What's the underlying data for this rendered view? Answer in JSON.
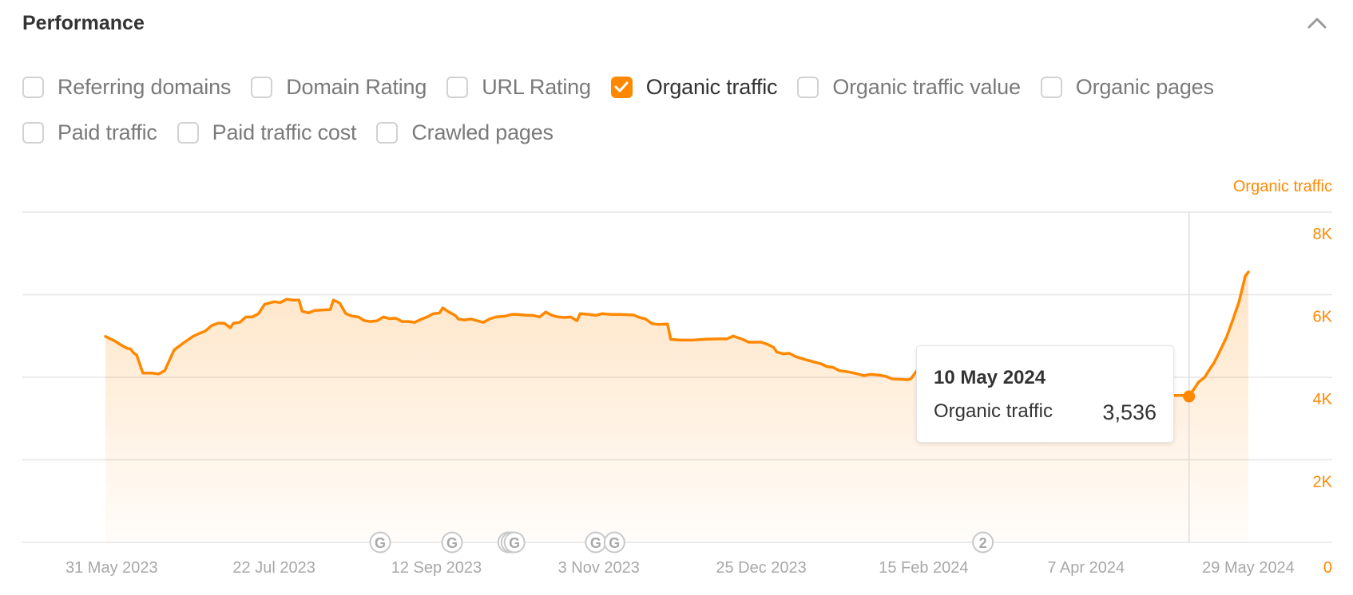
{
  "header": {
    "title": "Performance",
    "collapse_icon": "chevron-up-icon"
  },
  "metrics": [
    {
      "label": "Referring domains",
      "checked": false
    },
    {
      "label": "Domain Rating",
      "checked": false
    },
    {
      "label": "URL Rating",
      "checked": false
    },
    {
      "label": "Organic traffic",
      "checked": true
    },
    {
      "label": "Organic traffic value",
      "checked": false
    },
    {
      "label": "Organic pages",
      "checked": false
    },
    {
      "label": "Paid traffic",
      "checked": false
    },
    {
      "label": "Paid traffic cost",
      "checked": false
    },
    {
      "label": "Crawled pages",
      "checked": false
    }
  ],
  "colors": {
    "accent": "#ff8800",
    "grid": "#e6e6e6",
    "axis_text": "#a8a8a8",
    "marker": "#c8c8c8"
  },
  "tooltip": {
    "date": "10 May 2024",
    "series_label": "Organic traffic",
    "value": "3,536"
  },
  "chart_data": {
    "type": "area",
    "title": "",
    "series_name": "Organic traffic",
    "right_axis_label": "Organic traffic",
    "ylim": [
      0,
      8000
    ],
    "y_ticks": [
      0,
      2000,
      4000,
      6000,
      8000
    ],
    "y_tick_labels": [
      "0",
      "2K",
      "4K",
      "6K",
      "8K"
    ],
    "x_range": [
      "2023-05-29",
      "2024-05-29"
    ],
    "x_tick_dates": [
      "2023-05-31",
      "2023-07-22",
      "2023-09-12",
      "2023-11-03",
      "2023-12-25",
      "2024-02-15",
      "2024-04-07",
      "2024-05-29"
    ],
    "x_tick_labels": [
      "31 May 2023",
      "22 Jul 2023",
      "12 Sep 2023",
      "3 Nov 2023",
      "25 Dec 2023",
      "15 Feb 2024",
      "7 Apr 2024",
      "29 May 2024"
    ],
    "grid": true,
    "points": [
      [
        "2023-05-29",
        4990
      ],
      [
        "2023-06-01",
        4880
      ],
      [
        "2023-06-03",
        4780
      ],
      [
        "2023-06-05",
        4700
      ],
      [
        "2023-06-06",
        4690
      ],
      [
        "2023-06-07",
        4590
      ],
      [
        "2023-06-08",
        4540
      ],
      [
        "2023-06-10",
        4100
      ],
      [
        "2023-06-13",
        4100
      ],
      [
        "2023-06-15",
        4080
      ],
      [
        "2023-06-17",
        4160
      ],
      [
        "2023-06-18",
        4330
      ],
      [
        "2023-06-20",
        4660
      ],
      [
        "2023-06-23",
        4830
      ],
      [
        "2023-06-26",
        4990
      ],
      [
        "2023-06-28",
        5060
      ],
      [
        "2023-06-30",
        5120
      ],
      [
        "2023-07-02",
        5250
      ],
      [
        "2023-07-04",
        5310
      ],
      [
        "2023-07-06",
        5310
      ],
      [
        "2023-07-08",
        5200
      ],
      [
        "2023-07-09",
        5310
      ],
      [
        "2023-07-11",
        5330
      ],
      [
        "2023-07-13",
        5460
      ],
      [
        "2023-07-15",
        5460
      ],
      [
        "2023-07-17",
        5540
      ],
      [
        "2023-07-19",
        5770
      ],
      [
        "2023-07-22",
        5830
      ],
      [
        "2023-07-24",
        5810
      ],
      [
        "2023-07-26",
        5890
      ],
      [
        "2023-07-28",
        5870
      ],
      [
        "2023-07-30",
        5870
      ],
      [
        "2023-07-31",
        5600
      ],
      [
        "2023-08-02",
        5560
      ],
      [
        "2023-08-04",
        5620
      ],
      [
        "2023-08-09",
        5640
      ],
      [
        "2023-08-10",
        5870
      ],
      [
        "2023-08-12",
        5800
      ],
      [
        "2023-08-14",
        5540
      ],
      [
        "2023-08-16",
        5480
      ],
      [
        "2023-08-18",
        5460
      ],
      [
        "2023-08-20",
        5370
      ],
      [
        "2023-08-22",
        5350
      ],
      [
        "2023-08-24",
        5370
      ],
      [
        "2023-08-26",
        5460
      ],
      [
        "2023-08-28",
        5420
      ],
      [
        "2023-08-30",
        5430
      ],
      [
        "2023-09-01",
        5350
      ],
      [
        "2023-09-03",
        5350
      ],
      [
        "2023-09-05",
        5330
      ],
      [
        "2023-09-07",
        5400
      ],
      [
        "2023-09-09",
        5460
      ],
      [
        "2023-09-11",
        5540
      ],
      [
        "2023-09-13",
        5560
      ],
      [
        "2023-09-14",
        5680
      ],
      [
        "2023-09-16",
        5580
      ],
      [
        "2023-09-18",
        5500
      ],
      [
        "2023-09-19",
        5410
      ],
      [
        "2023-09-21",
        5390
      ],
      [
        "2023-09-23",
        5410
      ],
      [
        "2023-09-25",
        5370
      ],
      [
        "2023-09-27",
        5330
      ],
      [
        "2023-09-29",
        5410
      ],
      [
        "2023-10-01",
        5460
      ],
      [
        "2023-10-04",
        5480
      ],
      [
        "2023-10-06",
        5520
      ],
      [
        "2023-10-08",
        5520
      ],
      [
        "2023-10-11",
        5500
      ],
      [
        "2023-10-13",
        5500
      ],
      [
        "2023-10-15",
        5460
      ],
      [
        "2023-10-17",
        5580
      ],
      [
        "2023-10-19",
        5500
      ],
      [
        "2023-10-21",
        5460
      ],
      [
        "2023-10-23",
        5450
      ],
      [
        "2023-10-25",
        5460
      ],
      [
        "2023-10-27",
        5370
      ],
      [
        "2023-10-28",
        5540
      ],
      [
        "2023-10-31",
        5520
      ],
      [
        "2023-11-02",
        5500
      ],
      [
        "2023-11-04",
        5540
      ],
      [
        "2023-11-07",
        5520
      ],
      [
        "2023-11-10",
        5520
      ],
      [
        "2023-11-14",
        5510
      ],
      [
        "2023-11-16",
        5450
      ],
      [
        "2023-11-18",
        5410
      ],
      [
        "2023-11-20",
        5300
      ],
      [
        "2023-11-22",
        5280
      ],
      [
        "2023-11-25",
        5290
      ],
      [
        "2023-11-26",
        4920
      ],
      [
        "2023-11-29",
        4900
      ],
      [
        "2023-12-03",
        4900
      ],
      [
        "2023-12-07",
        4920
      ],
      [
        "2023-12-11",
        4930
      ],
      [
        "2023-12-14",
        4930
      ],
      [
        "2023-12-16",
        5000
      ],
      [
        "2023-12-19",
        4920
      ],
      [
        "2023-12-21",
        4850
      ],
      [
        "2023-12-25",
        4850
      ],
      [
        "2023-12-27",
        4800
      ],
      [
        "2023-12-29",
        4720
      ],
      [
        "2023-12-30",
        4610
      ],
      [
        "2024-01-01",
        4570
      ],
      [
        "2024-01-03",
        4580
      ],
      [
        "2024-01-05",
        4500
      ],
      [
        "2024-01-08",
        4430
      ],
      [
        "2024-01-11",
        4370
      ],
      [
        "2024-01-13",
        4330
      ],
      [
        "2024-01-15",
        4260
      ],
      [
        "2024-01-17",
        4240
      ],
      [
        "2024-01-19",
        4160
      ],
      [
        "2024-01-22",
        4130
      ],
      [
        "2024-01-25",
        4080
      ],
      [
        "2024-01-27",
        4040
      ],
      [
        "2024-01-29",
        4070
      ],
      [
        "2024-02-01",
        4050
      ],
      [
        "2024-02-03",
        4020
      ],
      [
        "2024-02-05",
        3960
      ],
      [
        "2024-02-08",
        3950
      ],
      [
        "2024-02-10",
        3940
      ],
      [
        "2024-02-11",
        3970
      ],
      [
        "2024-02-13",
        4180
      ],
      [
        "2024-02-15",
        4200
      ],
      [
        "2024-02-18",
        4190
      ],
      [
        "2024-02-20",
        4160
      ],
      [
        "2024-02-22",
        4160
      ],
      [
        "2024-02-23",
        3990
      ],
      [
        "2024-02-27",
        3970
      ],
      [
        "2024-03-03",
        3960
      ],
      [
        "2024-03-06",
        3960
      ],
      [
        "2024-03-08",
        4030
      ],
      [
        "2024-03-11",
        4020
      ],
      [
        "2024-03-13",
        4000
      ],
      [
        "2024-03-15",
        3940
      ],
      [
        "2024-03-18",
        3930
      ],
      [
        "2024-03-20",
        3930
      ],
      [
        "2024-03-22",
        3990
      ],
      [
        "2024-03-25",
        4000
      ],
      [
        "2024-03-27",
        4020
      ],
      [
        "2024-03-29",
        3980
      ],
      [
        "2024-04-01",
        3970
      ],
      [
        "2024-04-04",
        3950
      ],
      [
        "2024-04-07",
        3930
      ],
      [
        "2024-04-12",
        3900
      ],
      [
        "2024-04-18",
        3850
      ],
      [
        "2024-04-24",
        3750
      ],
      [
        "2024-04-30",
        3650
      ],
      [
        "2024-05-05",
        3560
      ],
      [
        "2024-05-08",
        3560
      ],
      [
        "2024-05-10",
        3536
      ],
      [
        "2024-05-12",
        3760
      ],
      [
        "2024-05-13",
        3880
      ],
      [
        "2024-05-15",
        4000
      ],
      [
        "2024-05-17",
        4240
      ],
      [
        "2024-05-18",
        4350
      ],
      [
        "2024-05-20",
        4650
      ],
      [
        "2024-05-22",
        4970
      ],
      [
        "2024-05-24",
        5390
      ],
      [
        "2024-05-26",
        5830
      ],
      [
        "2024-05-28",
        6450
      ],
      [
        "2024-05-29",
        6550
      ]
    ],
    "hover": {
      "date": "2024-05-10",
      "value": 3536
    },
    "annotations": [
      {
        "date": "2023-08-25",
        "label": "G",
        "type": "google-update"
      },
      {
        "date": "2023-09-17",
        "label": "G",
        "type": "google-update"
      },
      {
        "date": "2023-10-05",
        "label": "G",
        "type": "google-update"
      },
      {
        "date": "2023-10-06",
        "label": "G",
        "type": "google-update"
      },
      {
        "date": "2023-10-07",
        "label": "G",
        "type": "google-update"
      },
      {
        "date": "2023-11-02",
        "label": "G",
        "type": "google-update"
      },
      {
        "date": "2023-11-08",
        "label": "G",
        "type": "google-update"
      },
      {
        "date": "2024-03-05",
        "label": "2",
        "type": "update-group"
      }
    ]
  }
}
